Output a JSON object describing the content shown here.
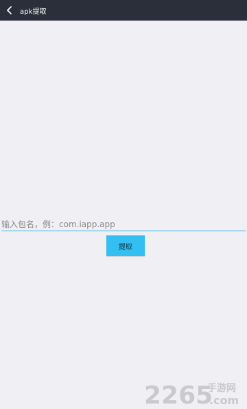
{
  "header": {
    "title": "apk提取",
    "back_icon": "back-arrow-icon"
  },
  "form": {
    "package_placeholder": "输入包名，例：com.iapp.app",
    "package_value": "",
    "extract_label": "提取"
  },
  "watermark": {
    "brand_number": "2265",
    "brand_cn": "手游网",
    "brand_domain": ".com"
  },
  "colors": {
    "appbar": "#2b2f3a",
    "background": "#efeff4",
    "accent": "#33bff1",
    "input_underline": "#35b4e8",
    "watermark": "#c9c9cf"
  }
}
